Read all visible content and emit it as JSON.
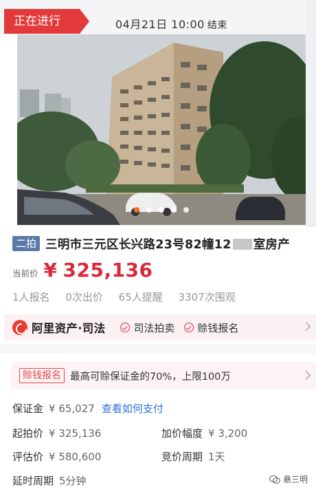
{
  "status": {
    "tag": "正在进行",
    "end_time": "04月21日 10:00",
    "end_suffix": "结束"
  },
  "gallery": {
    "slide_count": 5,
    "active_index": 0
  },
  "listing": {
    "round_badge": "二拍",
    "title_before": "三明市三元区长兴路23号82幢12",
    "title_after": "室房产",
    "price_label": "当前价",
    "price_currency": "¥",
    "price_value": "325,136"
  },
  "stats": {
    "signups": "1人报名",
    "bids": "0次出价",
    "reminders": "65人提醒",
    "views": "3307次围观"
  },
  "platform": {
    "brand": "阿里资产·司法",
    "feature1": "司法拍卖",
    "feature2": "赊钱报名"
  },
  "promo": {
    "tag": "赊钱报名",
    "text": "最高可赊保证金的70%，上限100万"
  },
  "info": {
    "deposit_label": "保证金",
    "deposit_value": "¥ 65,027",
    "deposit_link": "查看如何支付",
    "start_price_label": "起拍价",
    "start_price_value": "¥ 325,136",
    "increment_label": "加价幅度",
    "increment_value": "¥ 3,200",
    "appraisal_label": "评估价",
    "appraisal_value": "¥ 580,600",
    "bid_period_label": "竞价周期",
    "bid_period_value": "1天",
    "delay_period_label": "延时周期",
    "delay_period_value": "5分钟"
  },
  "watermark": {
    "text": "悬三明"
  },
  "colors": {
    "accent_red": "#d92a3b",
    "tag_red": "#e23a3a",
    "badge_blue": "#5a78a8",
    "link_blue": "#2d6fd8"
  },
  "icons": [
    "alibaba-asset-logo-icon",
    "check-circle-icon",
    "chevron-right-icon",
    "wechat-icon"
  ]
}
